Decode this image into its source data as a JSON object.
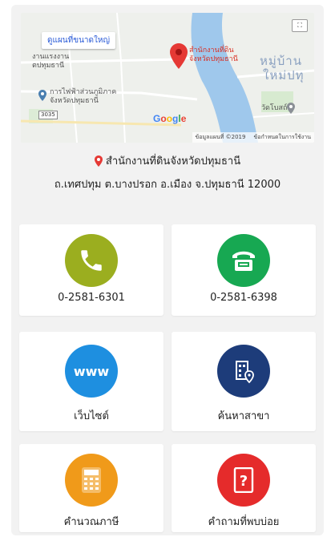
{
  "map": {
    "enlarge_link": "ดูแผนที่ขนาดใหญ่",
    "labels": {
      "area_top_left_1": "งานแรงงาน",
      "area_top_left_2": "ตปทุมธานี",
      "pin_label_1": "สำนักงานที่ดิน",
      "pin_label_2": "จังหวัดปทุมธานี",
      "area_right_1": "หมู่บ้าน",
      "area_right_2": "ใหม่ปทุ",
      "poi_1_line1": "การไฟฟ้าส่วนภูมิภาค",
      "poi_1_line2": "จังหวัดปทุมธานี",
      "road_number": "3035",
      "poi_2": "วัดโบสถ์"
    },
    "google": [
      "G",
      "o",
      "o",
      "g",
      "l",
      "e"
    ],
    "footer_data": "ข้อมูลแผนที่ ©2019",
    "footer_terms": "ข้อกำหนดในการใช้งาน",
    "fullscreen_icon": "fullscreen-icon"
  },
  "address": {
    "title": "สำนักงานที่ดินจังหวัดปทุมธานี",
    "line": "ถ.เทศปทุม ต.บางปรอก อ.เมือง จ.ปทุมธานี 12000"
  },
  "tiles": [
    {
      "label": "0-2581-6301",
      "icon": "phone-icon",
      "color": "#9bae1f"
    },
    {
      "label": "0-2581-6398",
      "icon": "fax-icon",
      "color": "#17a852"
    },
    {
      "label": "เว็บไซต์",
      "icon": "www-icon",
      "color": "#1e8fe0",
      "icon_text": "www"
    },
    {
      "label": "ค้นหาสาขา",
      "icon": "building-location-icon",
      "color": "#1d3c7a"
    },
    {
      "label": "คำนวณภาษี",
      "icon": "calculator-icon",
      "color": "#f09a1a"
    },
    {
      "label": "คำถามที่พบบ่อย",
      "icon": "question-icon",
      "color": "#e52b2b"
    }
  ],
  "colors": {
    "pin_red": "#e53935",
    "river": "#9fc8ec",
    "map_bg": "#eef0ec",
    "link_blue": "#2a5bd7"
  }
}
